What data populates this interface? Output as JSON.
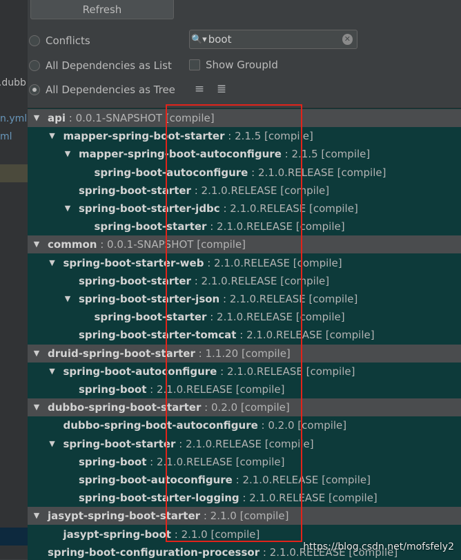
{
  "toolbar": {
    "refresh_label": "Refresh"
  },
  "options": {
    "conflicts_label": "Conflicts",
    "list_label": "All Dependencies as List",
    "tree_label": "All Dependencies as Tree",
    "show_group_id_label": "Show GroupId",
    "selected": "tree"
  },
  "search": {
    "value": "boot",
    "placeholder": ""
  },
  "left_strip": {
    "fragments": [
      "f.dubb",
      "n.yml",
      "ml"
    ]
  },
  "tree": [
    {
      "depth": 0,
      "expanded": true,
      "name": "api",
      "version": "0.0.1-SNAPSHOT [compile]"
    },
    {
      "depth": 1,
      "expanded": true,
      "name": "mapper-spring-boot-starter",
      "version": "2.1.5 [compile]"
    },
    {
      "depth": 2,
      "expanded": true,
      "name": "mapper-spring-boot-autoconfigure",
      "version": "2.1.5 [compile]"
    },
    {
      "depth": 3,
      "expanded": null,
      "name": "spring-boot-autoconfigure",
      "version": "2.1.0.RELEASE [compile]"
    },
    {
      "depth": 2,
      "expanded": null,
      "name": "spring-boot-starter",
      "version": "2.1.0.RELEASE [compile]"
    },
    {
      "depth": 2,
      "expanded": true,
      "name": "spring-boot-starter-jdbc",
      "version": "2.1.0.RELEASE [compile]"
    },
    {
      "depth": 3,
      "expanded": null,
      "name": "spring-boot-starter",
      "version": "2.1.0.RELEASE [compile]"
    },
    {
      "depth": 0,
      "expanded": true,
      "name": "common",
      "version": "0.0.1-SNAPSHOT [compile]"
    },
    {
      "depth": 1,
      "expanded": true,
      "name": "spring-boot-starter-web",
      "version": "2.1.0.RELEASE [compile]"
    },
    {
      "depth": 2,
      "expanded": null,
      "name": "spring-boot-starter",
      "version": "2.1.0.RELEASE [compile]"
    },
    {
      "depth": 2,
      "expanded": true,
      "name": "spring-boot-starter-json",
      "version": "2.1.0.RELEASE [compile]"
    },
    {
      "depth": 3,
      "expanded": null,
      "name": "spring-boot-starter",
      "version": "2.1.0.RELEASE [compile]"
    },
    {
      "depth": 2,
      "expanded": null,
      "name": "spring-boot-starter-tomcat",
      "version": "2.1.0.RELEASE [compile]"
    },
    {
      "depth": 0,
      "expanded": true,
      "name": "druid-spring-boot-starter",
      "version": "1.1.20 [compile]"
    },
    {
      "depth": 1,
      "expanded": true,
      "name": "spring-boot-autoconfigure",
      "version": "2.1.0.RELEASE [compile]"
    },
    {
      "depth": 2,
      "expanded": null,
      "name": "spring-boot",
      "version": "2.1.0.RELEASE [compile]"
    },
    {
      "depth": 0,
      "expanded": true,
      "name": "dubbo-spring-boot-starter",
      "version": "0.2.0 [compile]"
    },
    {
      "depth": 1,
      "expanded": null,
      "name": "dubbo-spring-boot-autoconfigure",
      "version": "0.2.0 [compile]"
    },
    {
      "depth": 1,
      "expanded": true,
      "name": "spring-boot-starter",
      "version": "2.1.0.RELEASE [compile]"
    },
    {
      "depth": 2,
      "expanded": null,
      "name": "spring-boot",
      "version": "2.1.0.RELEASE [compile]"
    },
    {
      "depth": 2,
      "expanded": null,
      "name": "spring-boot-autoconfigure",
      "version": "2.1.0.RELEASE [compile]"
    },
    {
      "depth": 2,
      "expanded": null,
      "name": "spring-boot-starter-logging",
      "version": "2.1.0.RELEASE [compile]"
    },
    {
      "depth": 0,
      "expanded": true,
      "name": "jasypt-spring-boot-starter",
      "version": "2.1.0 [compile]"
    },
    {
      "depth": 1,
      "expanded": null,
      "name": "jasypt-spring-boot",
      "version": "2.1.0 [compile]"
    },
    {
      "depth": 0,
      "expanded": null,
      "name": "spring-boot-configuration-processor",
      "version": "2.1.0.RELEASE [compile]"
    }
  ],
  "watermark": "https://blog.csdn.net/mofsfely2",
  "colors": {
    "tree_bg": "#0d3a3a",
    "root_row_bg": "#4a4c4e",
    "annotation_box": "#e2231a"
  }
}
